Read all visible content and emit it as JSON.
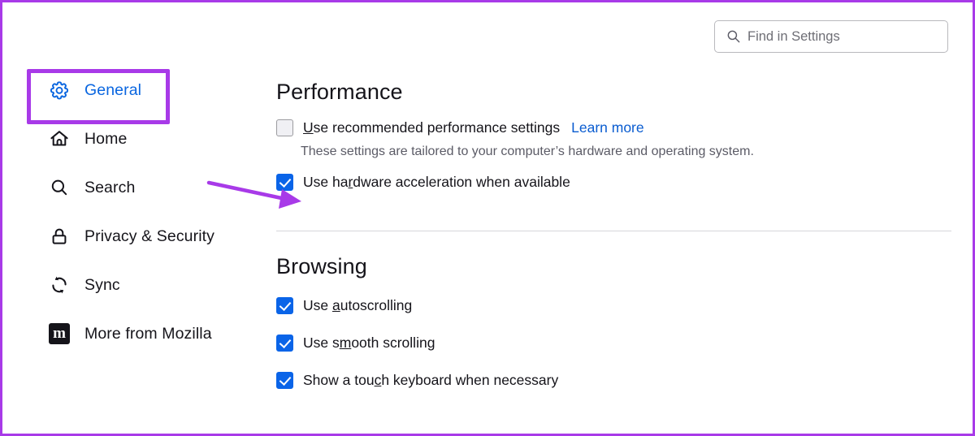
{
  "colors": {
    "annotation_purple": "#a83ae8",
    "accent_blue": "#0a64e8",
    "link_blue": "#0a5cd0",
    "text": "#15141a",
    "muted_text": "#5b5b66"
  },
  "search": {
    "placeholder": "Find in Settings",
    "value": "",
    "icon": "search-icon"
  },
  "sidebar": {
    "items": [
      {
        "label": "General",
        "icon": "gear-icon",
        "active": true
      },
      {
        "label": "Home",
        "icon": "home-icon",
        "active": false
      },
      {
        "label": "Search",
        "icon": "search-icon",
        "active": false
      },
      {
        "label": "Privacy & Security",
        "icon": "lock-icon",
        "active": false
      },
      {
        "label": "Sync",
        "icon": "sync-icon",
        "active": false
      },
      {
        "label": "More from Mozilla",
        "icon": "mozilla-icon",
        "active": false
      }
    ],
    "mozilla_glyph": "m"
  },
  "main": {
    "performance": {
      "title": "Performance",
      "recommended": {
        "label_before": "",
        "access_key": "U",
        "label_after": "se recommended performance settings",
        "checked": false,
        "learn_more": "Learn more"
      },
      "description": "These settings are tailored to your computer’s hardware and operating system.",
      "hardware_acceleration": {
        "label_before": "Use ha",
        "access_key": "r",
        "label_after": "dware acceleration when available",
        "checked": true
      }
    },
    "browsing": {
      "title": "Browsing",
      "options": [
        {
          "label_before": "Use ",
          "access_key": "a",
          "label_after": "utoscrolling",
          "checked": true
        },
        {
          "label_before": "Use s",
          "access_key": "m",
          "label_after": "ooth scrolling",
          "checked": true
        },
        {
          "label_before": "Show a tou",
          "access_key": "c",
          "label_after": "h keyboard when necessary",
          "checked": true
        }
      ]
    }
  },
  "annotations": {
    "highlight_target": "General",
    "arrow_target": "Use hardware acceleration when available"
  }
}
